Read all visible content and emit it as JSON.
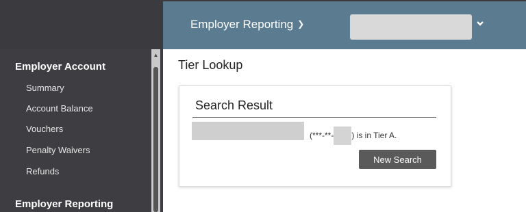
{
  "header": {
    "menu_label": "Employer Reporting",
    "select_value": ""
  },
  "sidebar": {
    "sections": [
      {
        "heading": "Employer Account",
        "items": [
          "Summary",
          "Account Balance",
          "Vouchers",
          "Penalty Waivers",
          "Refunds"
        ]
      },
      {
        "heading": "Employer Reporting",
        "items": []
      }
    ]
  },
  "main": {
    "title": "Tier Lookup",
    "card": {
      "heading": "Search Result",
      "ssn_prefix": "(***-**-",
      "ssn_suffix": ") is in Tier A.",
      "button_label": "New Search"
    }
  },
  "colors": {
    "sidebar_bg": "#3e3e42",
    "header_bg": "#5b7b90",
    "button_bg": "#5a5a5a"
  }
}
